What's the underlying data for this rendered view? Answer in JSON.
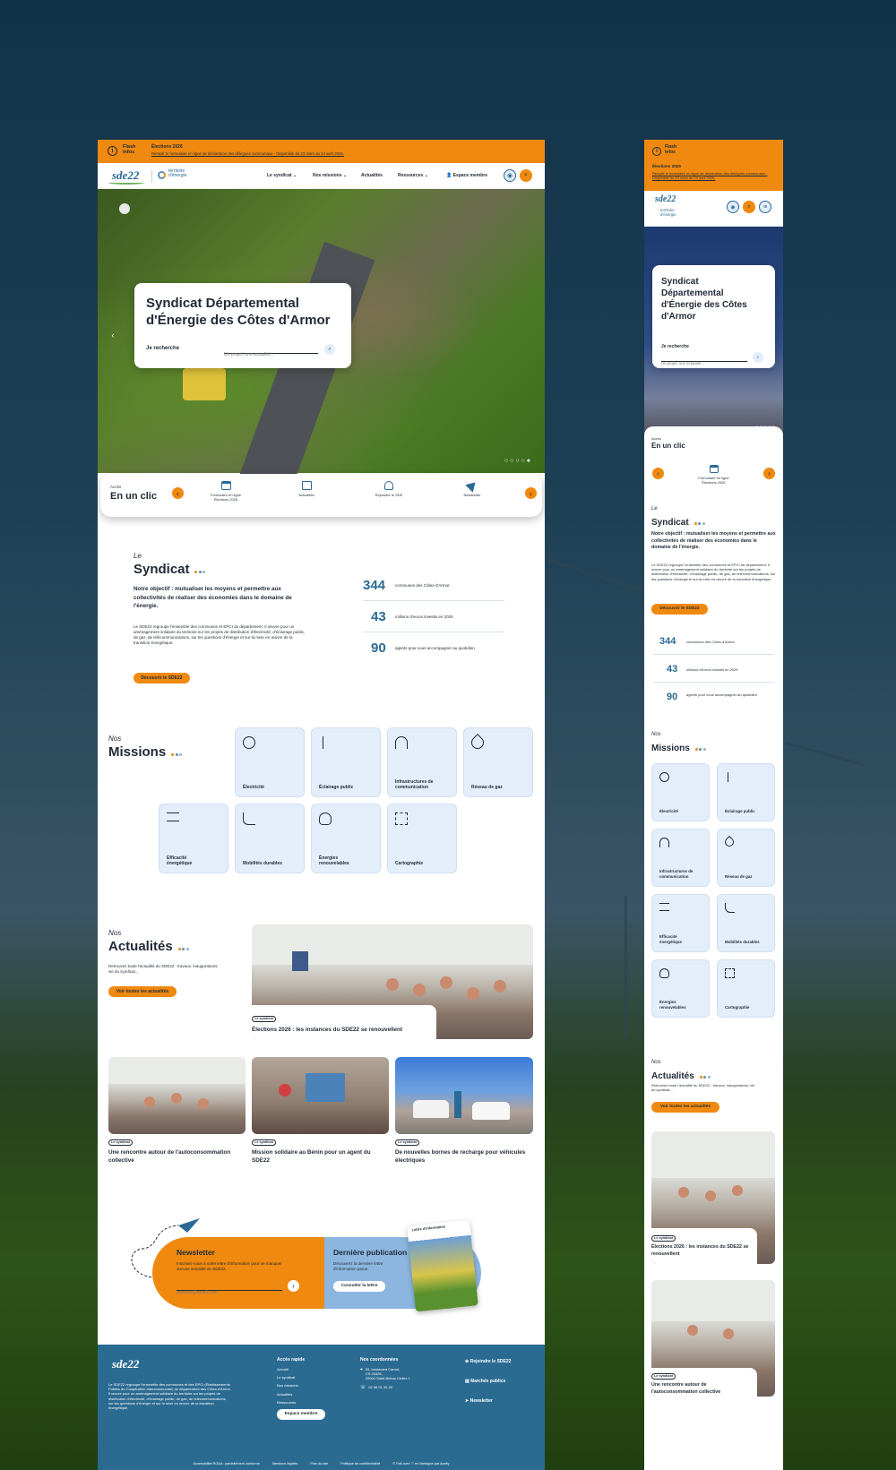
{
  "flash": {
    "label": "Flash\ninfos",
    "title": "Élections 2026",
    "text": "Remplir le formulaire en ligne de déclaration des délégués communaux - Disponible du 23 mars au 24 avril 2026."
  },
  "nav": {
    "logo": "sde22",
    "partner": "territoire d'énergie",
    "items": [
      "Le syndicat",
      "Nos missions",
      "Actualités",
      "Ressources"
    ],
    "member": "Espace membre"
  },
  "hero": {
    "title": "Syndicat Départemental d'Énergie des Côtes d'Armor",
    "search_label": "Je recherche",
    "search_placeholder": "Un projet, une actualité..."
  },
  "quick": {
    "small": "Accès",
    "big": "En un clic",
    "items": [
      "Formulaire en ligne\nÉlections 2026",
      "Actualités",
      "Rejoindre le SDE",
      "Newsletter"
    ]
  },
  "syndicat": {
    "small": "Le",
    "big": "Syndicat",
    "lead": "Notre objectif : mutualiser les moyens et permettre aux collectivités de réaliser des économies dans le domaine de l'énergie.",
    "body": "Le SDE22 regroupe l'ensemble des communes et EPCI du département. Il œuvre pour un aménagement solidaire du territoire sur les projets de distribution d'électricité, d'éclairage public, de gaz, de télécommunications, sur les questions d'énergie et sur la mise en œuvre de la transition énergétique.",
    "cta": "Découvrir le SDE22",
    "stats": [
      {
        "value": "344",
        "label": "communes des Côtes-d'Armor"
      },
      {
        "value": "43",
        "label": "millions d'euros investis en 2025"
      },
      {
        "value": "90",
        "label": "agents pour vous accompagner au quotidien"
      }
    ]
  },
  "missions": {
    "small": "Nos",
    "big": "Missions",
    "items": [
      "Électricité",
      "Éclairage public",
      "Infrastructures de communication",
      "Réseau de gaz",
      "Efficacité énergétique",
      "Mobilités durables",
      "Énergies renouvelables",
      "Cartographie"
    ]
  },
  "news": {
    "small": "Nos",
    "big": "Actualités",
    "intro": "Retrouvez toute l'actualité du SDE22 : travaux, inaugurations, vie du syndicat...",
    "cta": "Voir toutes les actualités",
    "featured": {
      "tag": "Le syndicat",
      "title": "Élections 2026 : les instances du SDE22 se renouvellent"
    },
    "items": [
      {
        "tag": "Le syndicat",
        "title": "Une rencontre autour de l'autoconsommation collective"
      },
      {
        "tag": "Le syndicat",
        "title": "Mission solidaire au Bénin pour un agent du SDE22"
      },
      {
        "tag": "Le syndicat",
        "title": "De nouvelles bornes de recharge pour véhicules électriques"
      }
    ]
  },
  "newsletter": {
    "title": "Newsletter",
    "text": "Inscrivez-vous à notre lettre d'information pour ne manquer aucune actualité du SDE22.",
    "placeholder": "adresse@email.com",
    "pub_title": "Dernière publication",
    "pub_text": "Découvrez la dernière lettre d'information parue.",
    "pub_cta": "Consulter la lettre",
    "cover_title": "Lettre d'information"
  },
  "footer": {
    "logo": "sde22",
    "about": "Le SDE22 regroupe l'ensemble des communes et des EPCI (Établissements Publics de Coopération Intercommunale) du département des Côtes-d'Armor. Il œuvre pour un aménagement solidaire du territoire sur les projets de distribution d'électricité, d'éclairage public, de gaz, de télécommunications, sur les questions d'énergie et sur la mise en œuvre de la transition énergétique.",
    "quick_title": "Accès rapide",
    "quick_links": [
      "Accueil",
      "Le syndicat",
      "Nos missions",
      "Actualités",
      "Ressources"
    ],
    "member": "Espace membre",
    "contact_title": "Nos coordonnées",
    "address": "53, boulevard Carnot,\nCS 20426,\n22004 Saint-Brieuc Cedex 1",
    "phone": "02 96 01 20 20",
    "actions": [
      "Rejoindre le SDE22",
      "Marchés publics",
      "Newsletter"
    ],
    "bottom": [
      "Accessibilité RGAA : partiellement conforme",
      "Mentions légales",
      "Plan du site",
      "Politique de confidentialité",
      "© Fait avec ♡ en Bretagne par Acelty"
    ]
  },
  "mobile": {
    "flash_label": "Flash\ninfos",
    "flash_title": "Élections 2026",
    "flash_text": "Remplir le formulaire en ligne de déclaration des délégués communaux - Disponible du 23 mars au 24 avril 2026.",
    "hero_title": "Syndicat Départemental d'Énergie des Côtes d'Armor",
    "search_label": "Je recherche",
    "search_placeholder": "Un projet, une actualité...",
    "quick_small": "Accès",
    "quick_big": "En un clic",
    "quick_item": "Formulaire en ligne\nÉlections 2026"
  },
  "colors": {
    "orange": "#f0890f",
    "blue": "#2a6a94",
    "pale": "#e3eefa",
    "dot_blue": "#5a8fbf",
    "dot_grey": "#9fb0c0"
  }
}
